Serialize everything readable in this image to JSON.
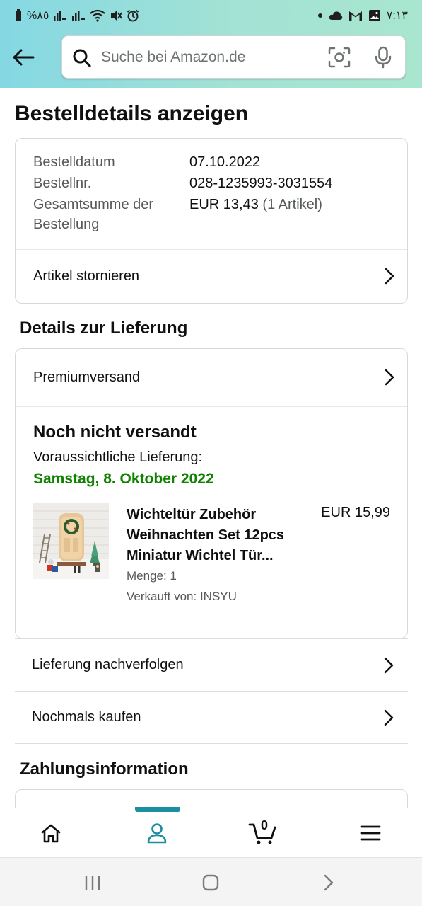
{
  "status_bar": {
    "battery": "%٨٥",
    "time": "٧:١٣"
  },
  "search": {
    "placeholder": "Suche bei Amazon.de"
  },
  "page_title": "Bestelldetails anzeigen",
  "order_summary": {
    "date_label": "Bestelldatum",
    "date_value": "07.10.2022",
    "number_label": "Bestellnr.",
    "number_value": "028-1235993-3031554",
    "total_label_line1": "Gesamtsumme der",
    "total_label_line2": "Bestellung",
    "total_value": "EUR 13,43",
    "total_items": "(1 Artikel)",
    "cancel_label": "Artikel stornieren"
  },
  "delivery": {
    "section_title": "Details zur Lieferung",
    "shipping_method": "Premiumversand",
    "status": "Noch nicht versandt",
    "expected_label": "Voraussichtliche Lieferung:",
    "expected_date": "Samstag, 8. Oktober 2022",
    "product": {
      "name": "Wichteltür Zubehör Weihnachten Set 12pcs Miniatur Wichtel Tür...",
      "price": "EUR 15,99",
      "quantity": "Menge: 1",
      "seller": "Verkauft von: INSYU"
    },
    "track_label": "Lieferung nachverfolgen",
    "buy_again_label": "Nochmals kaufen"
  },
  "payment": {
    "section_title": "Zahlungsinformation"
  },
  "bottom_nav": {
    "cart_count": "0",
    "active_tab": "account"
  },
  "colors": {
    "accent": "#1b8fa0",
    "delivery_date": "#118200",
    "header_gradient_start": "#84d8e3",
    "header_gradient_end": "#a8e6cf"
  }
}
